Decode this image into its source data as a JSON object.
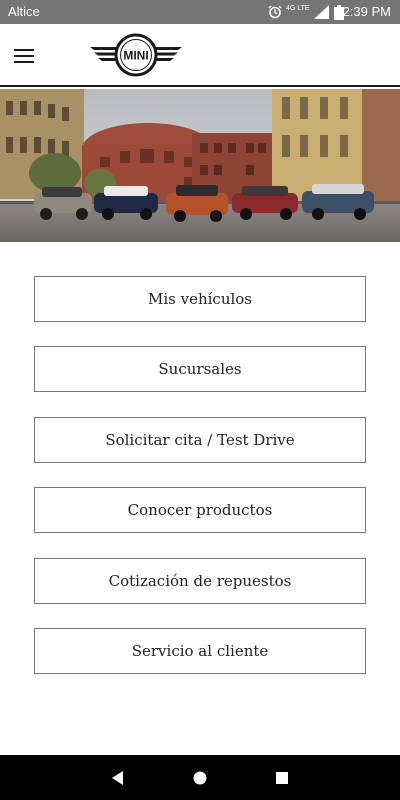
{
  "status_bar": {
    "carrier": "Altice",
    "network": "4G LTE",
    "time": "12:39 PM",
    "icons": [
      "alarm-icon",
      "signal-icon",
      "battery-icon"
    ]
  },
  "header": {
    "logo_text": "MINI",
    "menu_icon": "hamburger-menu-icon"
  },
  "hero": {
    "description_icon": "hero-image"
  },
  "menu": {
    "items": [
      {
        "label": "Mis vehículos"
      },
      {
        "label": "Sucursales"
      },
      {
        "label": "Solicitar cita / Test Drive"
      },
      {
        "label": "Conocer productos"
      },
      {
        "label": "Cotización de repuestos"
      },
      {
        "label": "Servicio al cliente"
      }
    ]
  },
  "nav_bar": {
    "buttons": [
      "back-icon",
      "home-icon",
      "recent-apps-icon"
    ]
  },
  "colors": {
    "status_bar": "#757575",
    "nav_bar": "#000000",
    "border": "#7a7a7a",
    "text": "#222222"
  }
}
